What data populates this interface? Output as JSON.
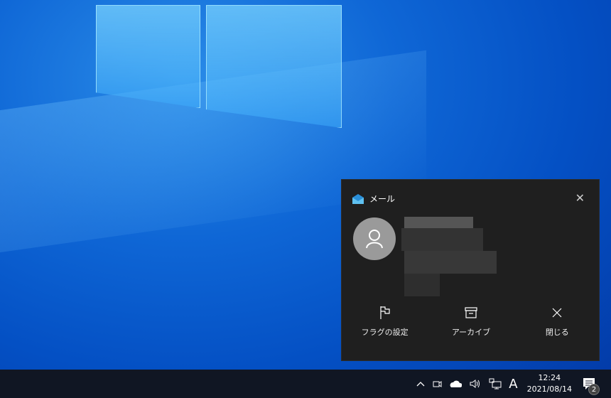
{
  "notification": {
    "app_name": "メール",
    "actions": [
      {
        "label": "フラグの設定",
        "icon": "flag-icon"
      },
      {
        "label": "アーカイブ",
        "icon": "archive-icon"
      },
      {
        "label": "閉じる",
        "icon": "close-icon"
      }
    ]
  },
  "taskbar": {
    "time": "12:24",
    "date": "2021/08/14",
    "ime": "A",
    "notification_count": "2"
  }
}
